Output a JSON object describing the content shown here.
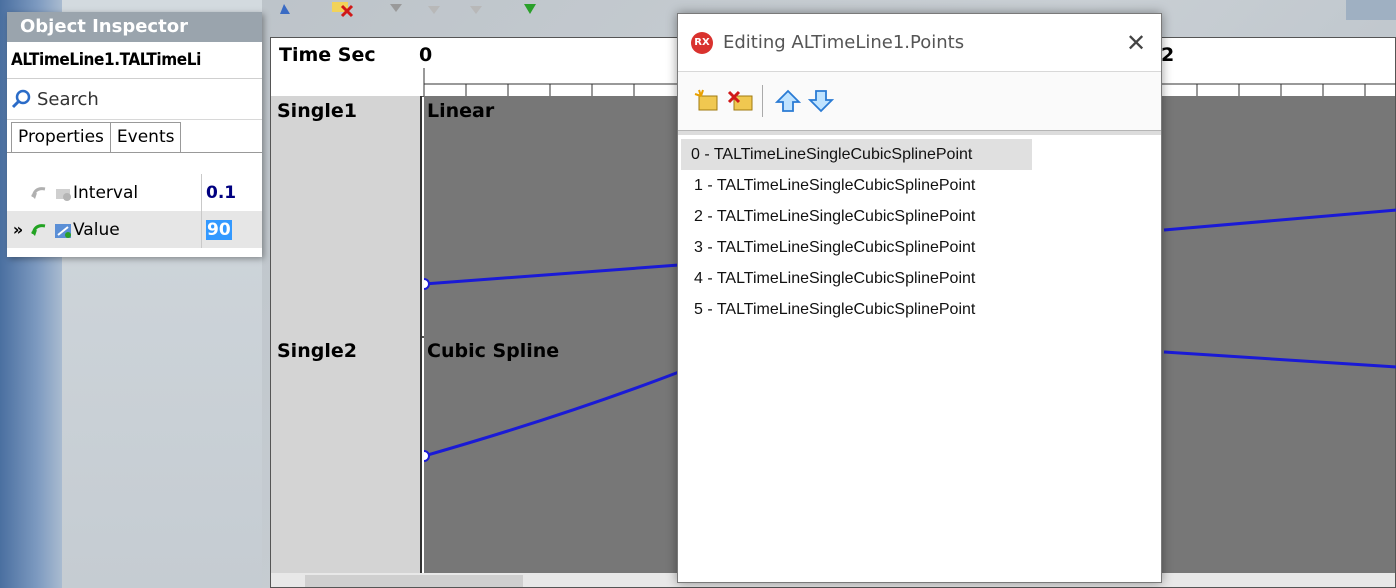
{
  "object_inspector": {
    "title": "Object Inspector",
    "object_name": "ALTimeLine1.TALTimeLi",
    "search_placeholder": "Search",
    "tabs": [
      "Properties",
      "Events"
    ],
    "properties": [
      {
        "marker": "",
        "name": "Interval",
        "value": "0.1",
        "selected": false
      },
      {
        "marker": "»",
        "name": "Value",
        "value": "90",
        "selected": true
      }
    ]
  },
  "timeline": {
    "header_label": "Time Sec",
    "tick_zero": "0",
    "tick_right": "2",
    "tracks": [
      {
        "name": "Single1",
        "interpolation": "Linear"
      },
      {
        "name": "Single2",
        "interpolation": "Cubic Spline"
      }
    ],
    "curve_color": "#1a1ad6"
  },
  "dialog": {
    "logo_text": "RX",
    "title": "Editing ALTimeLine1.Points",
    "close_glyph": "✕",
    "toolbar": [
      {
        "icon": "add-item-icon"
      },
      {
        "icon": "delete-item-icon"
      },
      {
        "icon": "move-up-icon"
      },
      {
        "icon": "move-down-icon"
      }
    ],
    "items": [
      "0 - TALTimeLineSingleCubicSplinePoint",
      "1 - TALTimeLineSingleCubicSplinePoint",
      "2 - TALTimeLineSingleCubicSplinePoint",
      "3 - TALTimeLineSingleCubicSplinePoint",
      "4 - TALTimeLineSingleCubicSplinePoint",
      "5 - TALTimeLineSingleCubicSplinePoint"
    ],
    "selected_index": 0
  }
}
